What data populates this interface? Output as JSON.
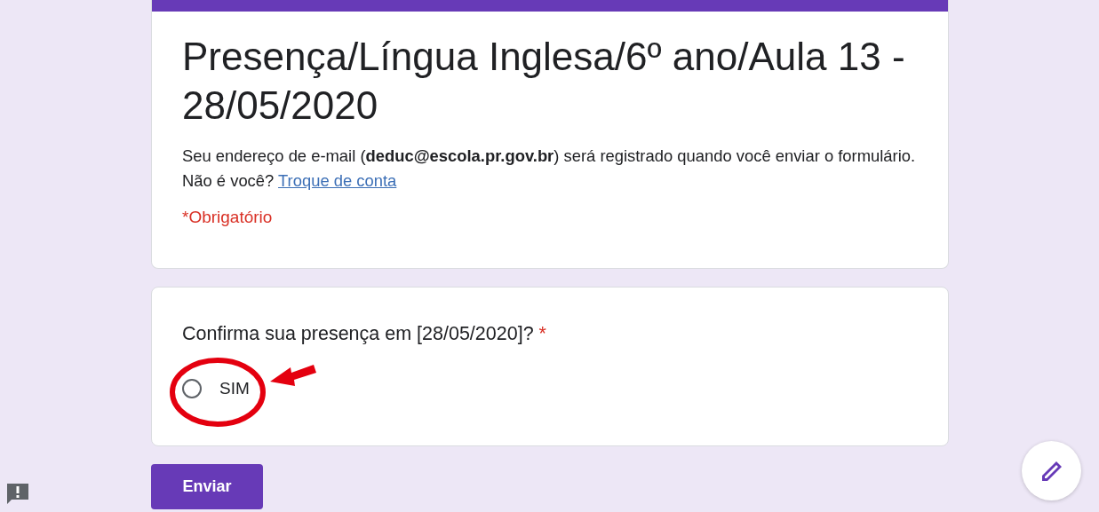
{
  "form": {
    "title": "Presença/Língua Inglesa/6º ano/Aula 13 - 28/05/2020",
    "email_notice": "Seu endereço de e-mail (**deduc@escola.pr.gov.br**) será registrado quando você enviar o formulário. Não é você?",
    "switch_account_link": "Troque de conta",
    "required_note": "*Obrigatório"
  },
  "question": {
    "title": "Confirma sua presença em [28/05/2020]?",
    "required_mark": "*",
    "options": [
      {
        "label": "SIM",
        "selected": false
      }
    ]
  },
  "submit_button": "Enviar"
}
